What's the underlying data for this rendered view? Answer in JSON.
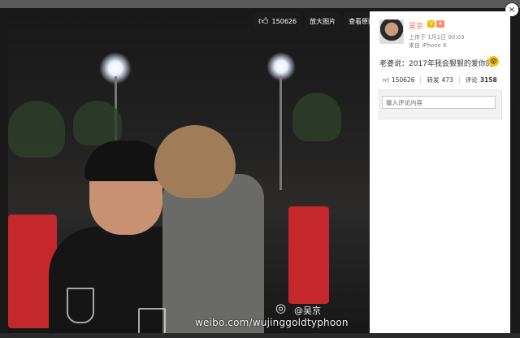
{
  "photo": {
    "toolbar": {
      "like_count": "150626",
      "enlarge_label": "放大图片",
      "original_label": "查看原图"
    },
    "watermark": {
      "user": "@吴京",
      "url": "weibo.com/wujinggoldtyphoon"
    }
  },
  "panel": {
    "username": "吴京",
    "badge": "V",
    "posted": "上传于 1月1日 00:03",
    "source": "来自 iPhone 6",
    "post_text": "老婆说：2017年我会狠狠的爱你的！",
    "actions": {
      "likes": "150626",
      "repost_label": "转发",
      "repost_count": "473",
      "comment_label": "评论",
      "comment_count": "3158"
    },
    "comment_placeholder": "输入评论内容"
  },
  "close_label": "×"
}
